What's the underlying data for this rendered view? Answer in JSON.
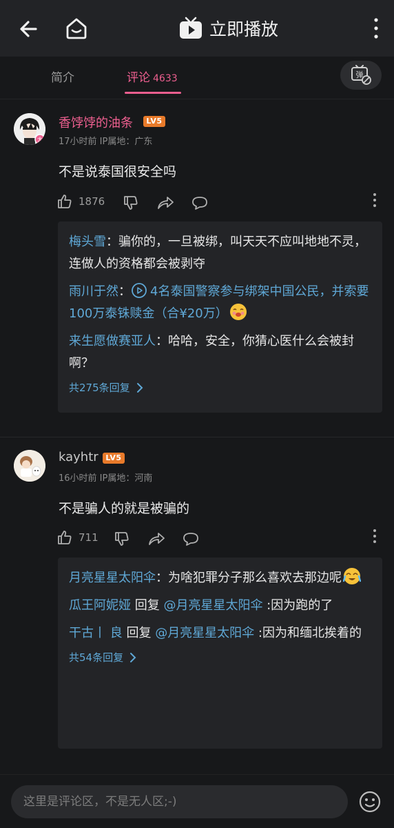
{
  "topbar": {
    "play_label": "立即播放"
  },
  "tabs": {
    "intro": "简介",
    "comments": "评论",
    "comments_count": "4633"
  },
  "comments": [
    {
      "username": "香饽饽的油条",
      "level": "LV5",
      "meta": "17小时前  IP属地：广东",
      "text": "不是说泰国很安全吗",
      "likes": "1876",
      "replies": [
        {
          "name": "梅头雪",
          "text": "：骗你的，一旦被绑，叫天天不应叫地地不灵，连做人的资格都会被剥夺"
        },
        {
          "name": "雨川于然",
          "text": "：",
          "link": "4名泰国警察参与绑架中国公民，并索要100万泰铢赎金（合¥20万）"
        },
        {
          "name": "来生愿做赛亚人",
          "text": "：哈哈，安全，你猜心医什么会被封啊？"
        }
      ],
      "more_replies": "共275条回复"
    },
    {
      "username": "kayhtr",
      "level": "LV5",
      "meta": "16小时前  IP属地：河南",
      "text": "不是骗人的就是被骗的",
      "likes": "711",
      "replies": [
        {
          "name": "月亮星星太阳伞",
          "text": "：为啥犯罪分子那么喜欢去那边呢"
        },
        {
          "name": "瓜王阿妮娅",
          "reply_word": " 回复 ",
          "target": "@月亮星星太阳伞",
          "text": " :因为跑的了"
        },
        {
          "name": "干古丨 良",
          "reply_word": " 回复 ",
          "target": "@月亮星星太阳伞",
          "text": " :因为和缅北挨着的"
        }
      ],
      "more_replies": "共54条回复"
    }
  ],
  "input": {
    "placeholder": "这里是评论区，不是无人区;-)"
  },
  "colors": {
    "accent": "#ec5f8f",
    "link": "#5fa8d6",
    "level": "#e87a2a",
    "background": "#17181a"
  }
}
